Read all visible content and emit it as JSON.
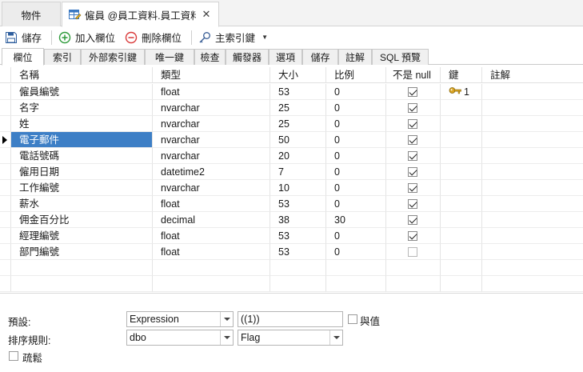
{
  "doc_tabs": {
    "objects_label": "物件",
    "active_title": "僱員 @員工資料.員工資料...",
    "close_glyph": "✕"
  },
  "toolbar": {
    "save": "儲存",
    "add_field": "加入欄位",
    "delete_field": "刪除欄位",
    "primary_key": "主索引鍵"
  },
  "subtabs": [
    "欄位",
    "索引",
    "外部索引鍵",
    "唯一鍵",
    "檢查",
    "觸發器",
    "選項",
    "儲存",
    "註解",
    "SQL 預覽"
  ],
  "grid": {
    "headers": [
      "名稱",
      "類型",
      "大小",
      "比例",
      "不是 null",
      "鍵",
      "註解"
    ],
    "rows": [
      {
        "name": "僱員編號",
        "type": "float",
        "size": "53",
        "scale": "0",
        "not_null": true,
        "key": "1",
        "comment": ""
      },
      {
        "name": "名字",
        "type": "nvarchar",
        "size": "25",
        "scale": "0",
        "not_null": true,
        "key": "",
        "comment": ""
      },
      {
        "name": "姓",
        "type": "nvarchar",
        "size": "25",
        "scale": "0",
        "not_null": true,
        "key": "",
        "comment": ""
      },
      {
        "name": "電子郵件",
        "type": "nvarchar",
        "size": "50",
        "scale": "0",
        "not_null": true,
        "key": "",
        "comment": ""
      },
      {
        "name": "電話號碼",
        "type": "nvarchar",
        "size": "20",
        "scale": "0",
        "not_null": true,
        "key": "",
        "comment": ""
      },
      {
        "name": "僱用日期",
        "type": "datetime2",
        "size": "7",
        "scale": "0",
        "not_null": true,
        "key": "",
        "comment": ""
      },
      {
        "name": "工作編號",
        "type": "nvarchar",
        "size": "10",
        "scale": "0",
        "not_null": true,
        "key": "",
        "comment": ""
      },
      {
        "name": "薪水",
        "type": "float",
        "size": "53",
        "scale": "0",
        "not_null": true,
        "key": "",
        "comment": ""
      },
      {
        "name": "佣金百分比",
        "type": "decimal",
        "size": "38",
        "scale": "30",
        "not_null": true,
        "key": "",
        "comment": ""
      },
      {
        "name": "經理編號",
        "type": "float",
        "size": "53",
        "scale": "0",
        "not_null": true,
        "key": "",
        "comment": ""
      },
      {
        "name": "部門編號",
        "type": "float",
        "size": "53",
        "scale": "0",
        "not_null": false,
        "key": "",
        "comment": ""
      }
    ]
  },
  "properties": {
    "default_label": "預設:",
    "default_type": "Expression",
    "default_value": "((1))",
    "identity_label": "與值",
    "collation_label": "排序規則:",
    "collation_schema": "dbo",
    "collation_name": "Flag",
    "sparse_label": "疏鬆"
  },
  "colors": {
    "selection": "#3d7fc6",
    "key_icon": "#d9a320",
    "add_icon": "#2e9b3a",
    "delete_icon": "#d93a3a"
  }
}
